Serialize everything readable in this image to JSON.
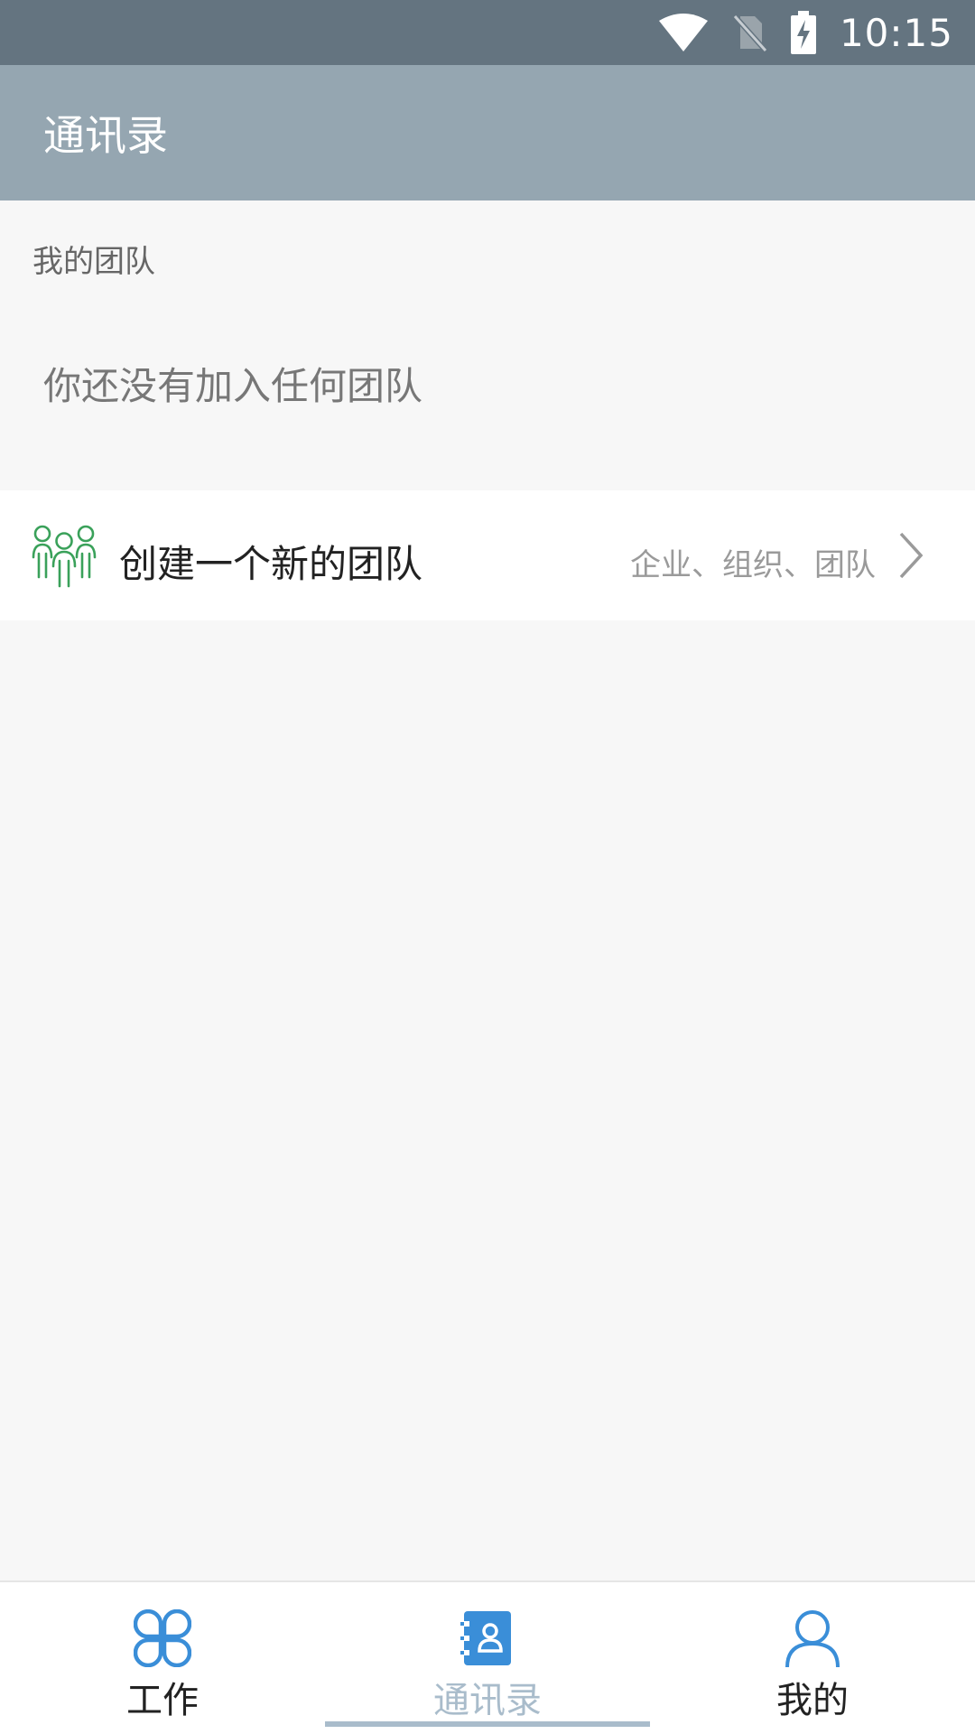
{
  "status_bar": {
    "time": "10:15",
    "icons": [
      "wifi-icon",
      "no-sim-icon",
      "battery-charging-icon"
    ]
  },
  "app_bar": {
    "title": "通讯录"
  },
  "my_teams": {
    "section_label": "我的团队",
    "empty_text": "你还没有加入任何团队"
  },
  "create_team": {
    "icon": "team-icon",
    "label": "创建一个新的团队",
    "hint": "企业、组织、团队",
    "accent_color": "#3aa15a"
  },
  "bottom_nav": {
    "active_color": "#a9bccb",
    "icon_color": "#3a8ed8",
    "items": [
      {
        "label": "工作",
        "icon": "grid-icon",
        "active": false
      },
      {
        "label": "通讯录",
        "icon": "contacts-book-icon",
        "active": true
      },
      {
        "label": "我的",
        "icon": "user-icon",
        "active": false
      }
    ]
  }
}
